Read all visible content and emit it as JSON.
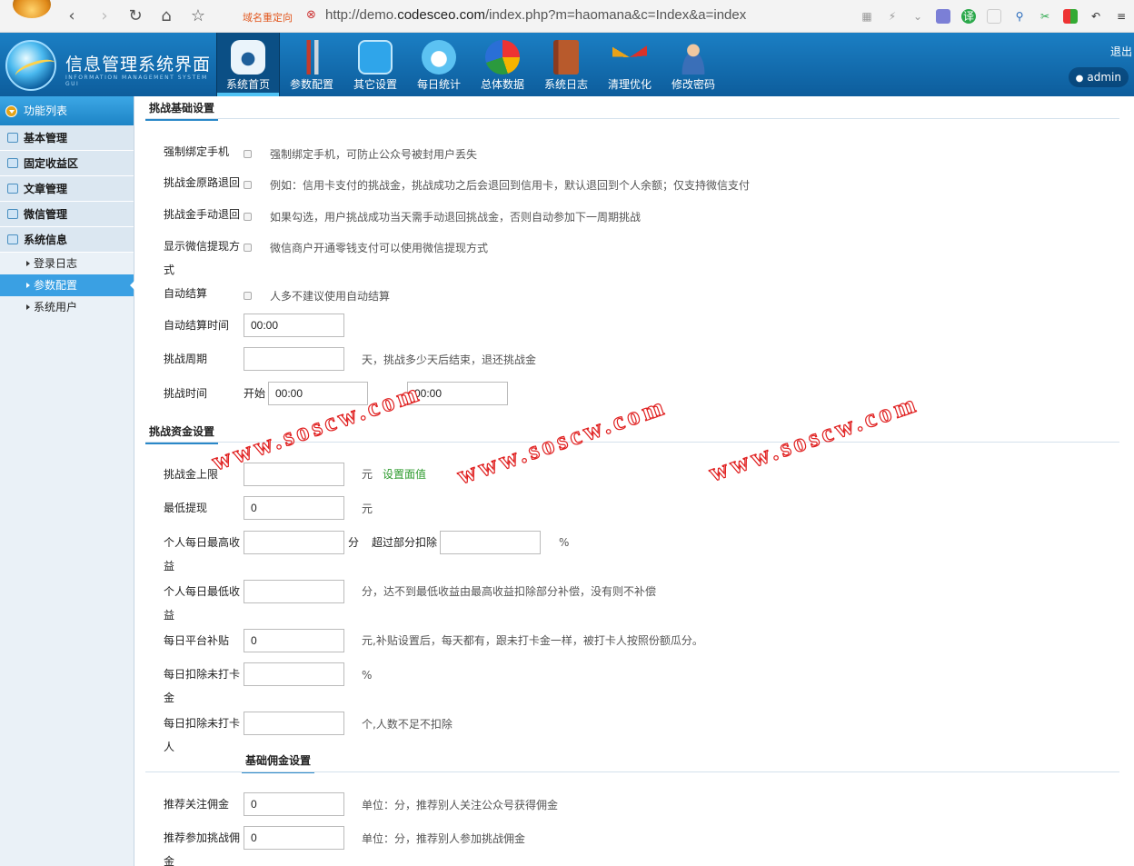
{
  "browser": {
    "redirect_label": "域名重定向",
    "url_prefix": "http://demo.",
    "url_domain": "codesceo.com",
    "url_path": "/index.php?m=haomana&c=Index&a=index"
  },
  "header": {
    "brand_title": "信息管理系统界面",
    "brand_subtitle": "INFORMATION MANAGEMENT SYSTEM GUI",
    "nav": [
      {
        "label": "系统首页",
        "icon": "home-camera-icon"
      },
      {
        "label": "参数配置",
        "icon": "tools-icon"
      },
      {
        "label": "其它设置",
        "icon": "exit-door-icon"
      },
      {
        "label": "每日统计",
        "icon": "yen-cloud-icon"
      },
      {
        "label": "总体数据",
        "icon": "pie-chart-icon"
      },
      {
        "label": "系统日志",
        "icon": "book-icon"
      },
      {
        "label": "清理优化",
        "icon": "drafting-tools-icon"
      },
      {
        "label": "修改密码",
        "icon": "user-icon"
      }
    ],
    "logout": "退出",
    "user": "admin"
  },
  "sidebar": {
    "title": "功能列表",
    "groups": [
      "基本管理",
      "固定收益区",
      "文章管理",
      "微信管理",
      "系统信息"
    ],
    "subs": [
      "登录日志",
      "参数配置",
      "系统用户"
    ]
  },
  "form": {
    "s1_title": "挑战基础设置",
    "r1_label": "强制绑定手机",
    "r1_hint": "强制绑定手机，可防止公众号被封用户丢失",
    "r2_label": "挑战金原路退回",
    "r2_hint": "例如：信用卡支付的挑战金，挑战成功之后会退回到信用卡，默认退回到个人余额；仅支持微信支付",
    "r3_label": "挑战金手动退回",
    "r3_hint": "如果勾选，用户挑战成功当天需手动退回挑战金，否则自动参加下一周期挑战",
    "r4_label": "显示微信提现方式",
    "r4_hint": "微信商户开通零钱支付可以使用微信提现方式",
    "r5_label": "自动结算",
    "r5_hint": "人多不建议使用自动结算",
    "r6_label": "自动结算时间",
    "r6_value": "00:00",
    "r7_label": "挑战周期",
    "r7_hint": "天，挑战多少天后结束，退还挑战金",
    "r8_label": "挑战时间",
    "r8_start": "开始",
    "r8_start_value": "00:00",
    "r8_end_value": "00:00",
    "s2_title": "挑战资金设置",
    "f1_label": "挑战金上限",
    "f1_unit": "元",
    "f1_link": "设置面值",
    "f2_label": "最低提现",
    "f2_value": "0",
    "f2_unit": "元",
    "f3_label": "个人每日最高收益",
    "f3_unit": "分",
    "f3_label2": "超过部分扣除",
    "f3_unit2": "%",
    "f4_label": "个人每日最低收益",
    "f4_hint": "分，达不到最低收益由最高收益扣除部分补偿，没有则不补偿",
    "f5_label": "每日平台补贴",
    "f5_value": "0",
    "f5_hint": "元,补贴设置后，每天都有，跟未打卡金一样，被打卡人按照份额瓜分。",
    "f6_label": "每日扣除未打卡金",
    "f6_unit": "%",
    "f7_label": "每日扣除未打卡人",
    "f7_hint": "个,人数不足不扣除",
    "s3_title": "基础佣金设置",
    "c1_label": "推荐关注佣金",
    "c1_value": "0",
    "c1_hint": "单位：分，推荐别人关注公众号获得佣金",
    "c2_label": "推荐参加挑战佣金",
    "c2_value": "0",
    "c2_hint": "单位：分，推荐别人参加挑战佣金"
  },
  "watermark": "www.soscw.com",
  "colors": {
    "header": "#1b7fc4",
    "accent": "#2a88c8",
    "sidebar_active": "#3aa0e3",
    "watermark": "#e02020"
  }
}
